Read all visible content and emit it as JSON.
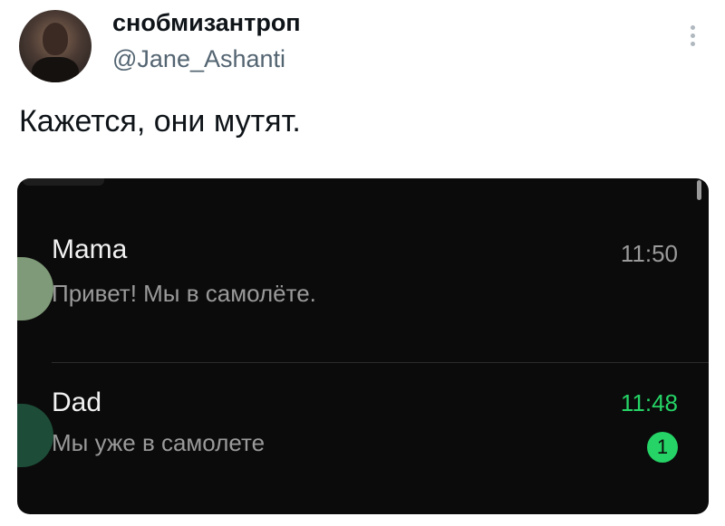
{
  "tweet": {
    "display_name": "снобмизантроп",
    "handle": "@Jane_Ashanti",
    "text": "Кажется, они мутят."
  },
  "chats": [
    {
      "name": "Mama",
      "message": "Привет! Мы в самолёте.",
      "time": "11:50",
      "time_color": "#9a9a9a"
    },
    {
      "name": "Dad",
      "message": "Мы уже в самолете",
      "time": "11:48",
      "time_color": "#25d366",
      "unread": "1"
    }
  ],
  "colors": {
    "accent_green": "#25d366",
    "card_bg": "#0b0b0b",
    "handle_gray": "#536471"
  },
  "icons": {
    "more": "more-vertical-icon"
  }
}
